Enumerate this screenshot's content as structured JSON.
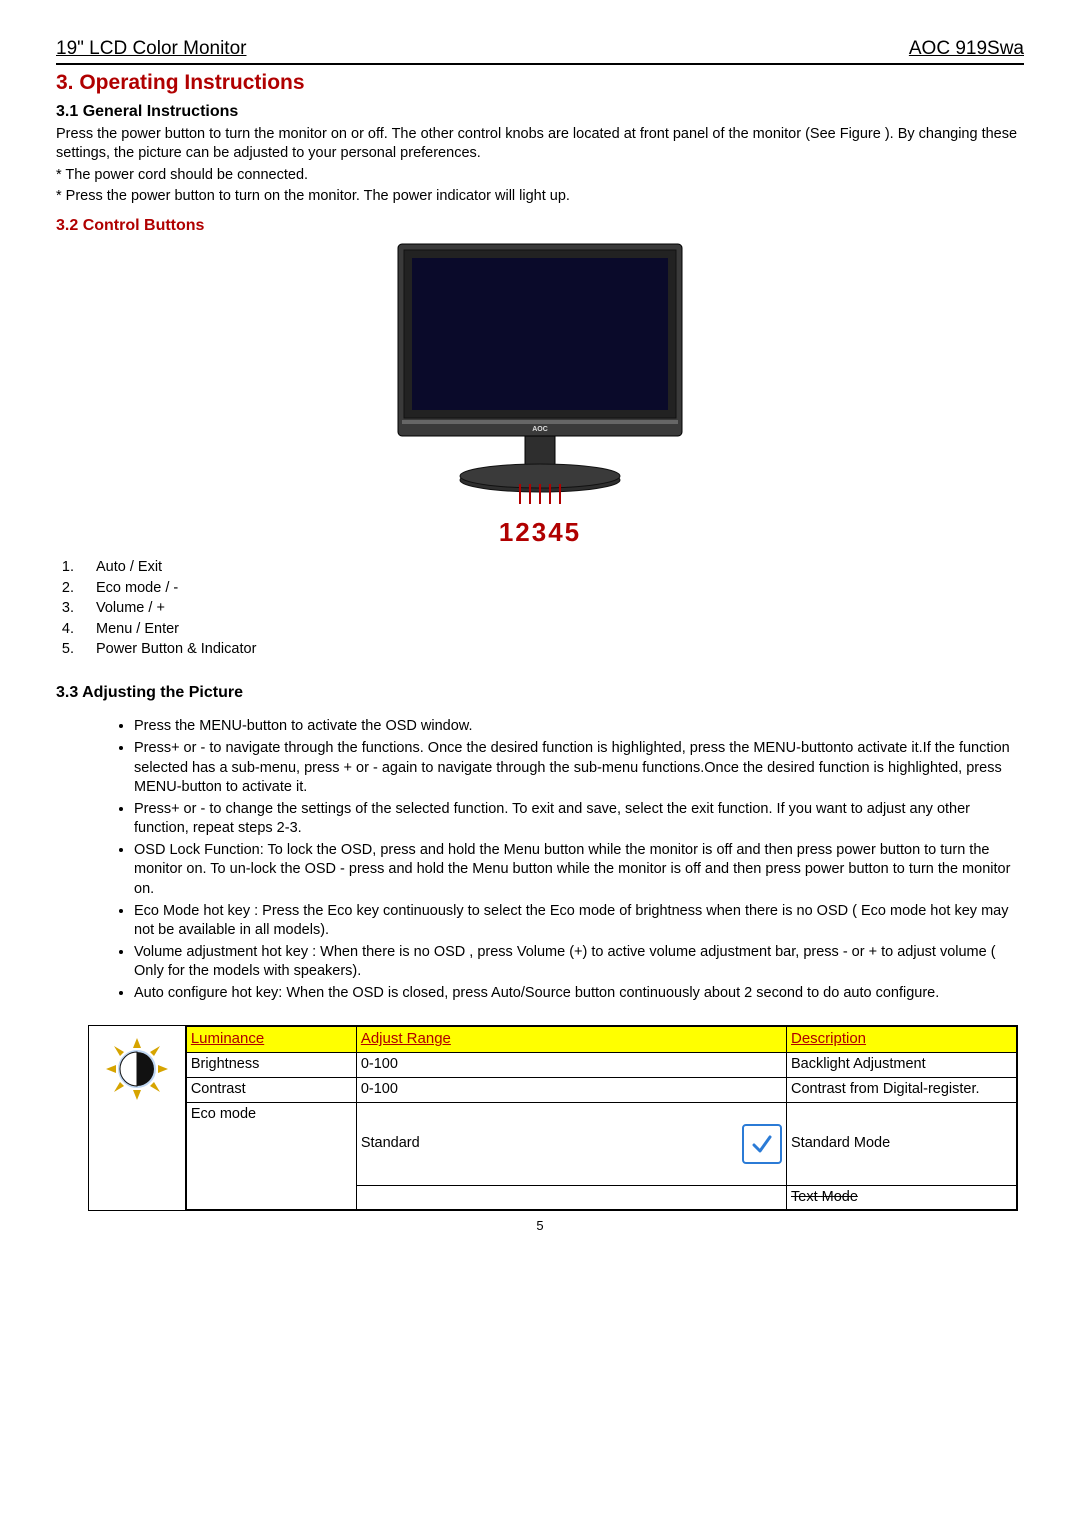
{
  "header": {
    "left": "19\" LCD Color Monitor",
    "right": "AOC 919Swa"
  },
  "section_title": "3. Operating Instructions",
  "s31": {
    "title": "3.1 General Instructions",
    "para1": "Press the power button to turn the monitor on or off. The other control knobs are located at front panel of the monitor (See Figure ). By changing these settings, the picture can be adjusted to your personal preferences.",
    "bullet1": "* The power cord should be connected.",
    "bullet2": "* Press the power button to turn on the monitor. The power indicator will light up."
  },
  "s32": {
    "title": "3.2 Control Buttons",
    "monitor_brand": "AOC",
    "digits": "12345",
    "buttons": [
      "Auto / Exit",
      "Eco mode / -",
      "Volume / +",
      "Menu / Enter",
      "Power Button & Indicator"
    ]
  },
  "s33": {
    "title": "3.3 Adjusting the Picture",
    "items": [
      "Press the MENU-button to activate the OSD window.",
      "Press+ or - to navigate through the functions. Once the desired function is highlighted, press the MENU-buttonto activate it.If the function selected has a sub-menu, press + or - again to navigate through the sub-menu functions.Once the desired function is highlighted, press MENU-button to activate it.",
      "Press+ or - to change the settings of the selected function. To exit and save, select the exit function. If you want to adjust any other function, repeat steps 2-3.",
      "OSD Lock Function: To lock the OSD, press and hold the Menu button while the monitor is off and then press power button to turn the monitor on. To un-lock the OSD - press and hold the Menu button while the monitor is off and then press power button to turn the monitor on.",
      "Eco Mode hot key : Press the Eco key continuously to select the Eco mode of brightness when there is no OSD ( Eco mode hot key may not be available in all models).",
      "Volume adjustment hot key : When there is no OSD , press Volume (+) to active volume adjustment bar, press - or + to adjust volume ( Only for the models with speakers).",
      "Auto configure hot key: When the OSD is closed, press Auto/Source button continuously about 2 second to do auto configure."
    ]
  },
  "table": {
    "headers": [
      "Luminance",
      "Adjust Range",
      "Description"
    ],
    "rows": [
      {
        "name": "Brightness",
        "range": "0-100",
        "desc": "Backlight Adjustment"
      },
      {
        "name": "Contrast",
        "range": "0-100",
        "desc": "Contrast from Digital-register."
      },
      {
        "name": "Eco mode",
        "range": "Standard",
        "desc": "Standard Mode"
      }
    ],
    "truncated_desc": "Text Mode"
  },
  "page_number": "5"
}
